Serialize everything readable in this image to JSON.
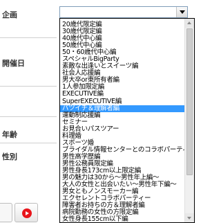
{
  "labels": {
    "plan": "企画",
    "date": "開催日",
    "age": "年齢",
    "gender": "性別"
  },
  "select": {
    "value": "",
    "options": [
      "20歳代限定編",
      "30歳代限定編",
      "40歳代中心編",
      "50歳代中心編",
      "50・60歳代中心編",
      "スペシャルBigParty",
      "素敵な出逢いとスイーツ編",
      "社会人応援編",
      "男大卒or東所有者編",
      "1人参加限定編",
      "EXECUTIVE編",
      "SuperEXECUTIVE編",
      "バツイチ＆理解者編",
      "運動制応援編",
      "セミナー",
      "お見合いパスツアー",
      "料理婚",
      "スポーツ婚",
      "ブライダル情報センターとのコラボパーティー",
      "男性高学歴編",
      "男性公務員限定編",
      "男性身長173cm以上限定編",
      "男の魅力は30から〜男性年上編〜",
      "大人の女性と出会いたい〜男性年下編〜",
      "男女ともノンスモーカー編",
      "エクセレントコラボパーティー",
      "障害者お持ちの方＆理解者編",
      "病院勤務の女性の方限定編",
      "女性身長155cm以下編"
    ],
    "selected_index": 12
  },
  "colors": {
    "highlight": "#3399ff",
    "next_button_icon": "#e8151b"
  },
  "icons": {
    "select_arrow": "chevron-down-icon",
    "next": "arrow-right-circle-icon"
  }
}
